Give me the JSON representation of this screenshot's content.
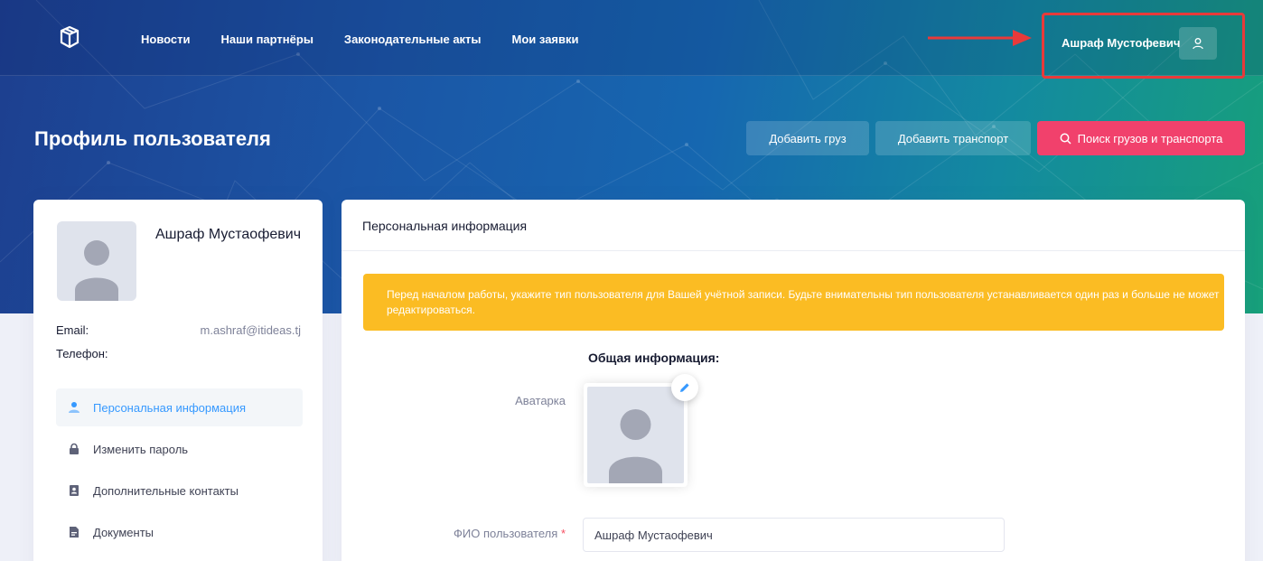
{
  "nav": {
    "items": [
      {
        "label": "Новости"
      },
      {
        "label": "Наши партнёры"
      },
      {
        "label": "Законодательные акты"
      },
      {
        "label": "Мои заявки"
      }
    ]
  },
  "user": {
    "name": "Ашраф Мустофевич",
    "avatar_icon": "user-icon"
  },
  "header": {
    "title": "Профиль пользователя",
    "buttons": {
      "add_cargo": "Добавить груз",
      "add_transport": "Добавить транспорт",
      "search": "Поиск грузов и транспорта"
    }
  },
  "profile": {
    "name": "Ашраф Мустаофевич",
    "email_label": "Email:",
    "email_value": "m.ashraf@itideas.tj",
    "phone_label": "Телефон:",
    "phone_value": ""
  },
  "sidebar": {
    "items": [
      {
        "label": "Персональная информация",
        "icon": "user-icon",
        "active": true
      },
      {
        "label": "Изменить пароль",
        "icon": "lock-icon",
        "active": false
      },
      {
        "label": "Дополнительные контакты",
        "icon": "contact-card-icon",
        "active": false
      },
      {
        "label": "Документы",
        "icon": "document-icon",
        "active": false
      }
    ]
  },
  "main": {
    "card_title": "Персональная информация",
    "alert_text": "Перед началом работы, укажите тип пользователя для Вашей учётной записи. Будьте внимательны тип пользователя устанавливается один раз и больше не может редактироваться.",
    "section_title": "Общая информация:",
    "avatar_label": "Аватарка",
    "fio_label": "ФИО пользователя",
    "fio_required_mark": "*",
    "fio_value": "Ашраф Мустаофевич"
  },
  "colors": {
    "accent": "#3699ff",
    "search_button": "#f1416c",
    "alert": "#fbbc23",
    "annotation": "#e83a3a"
  }
}
